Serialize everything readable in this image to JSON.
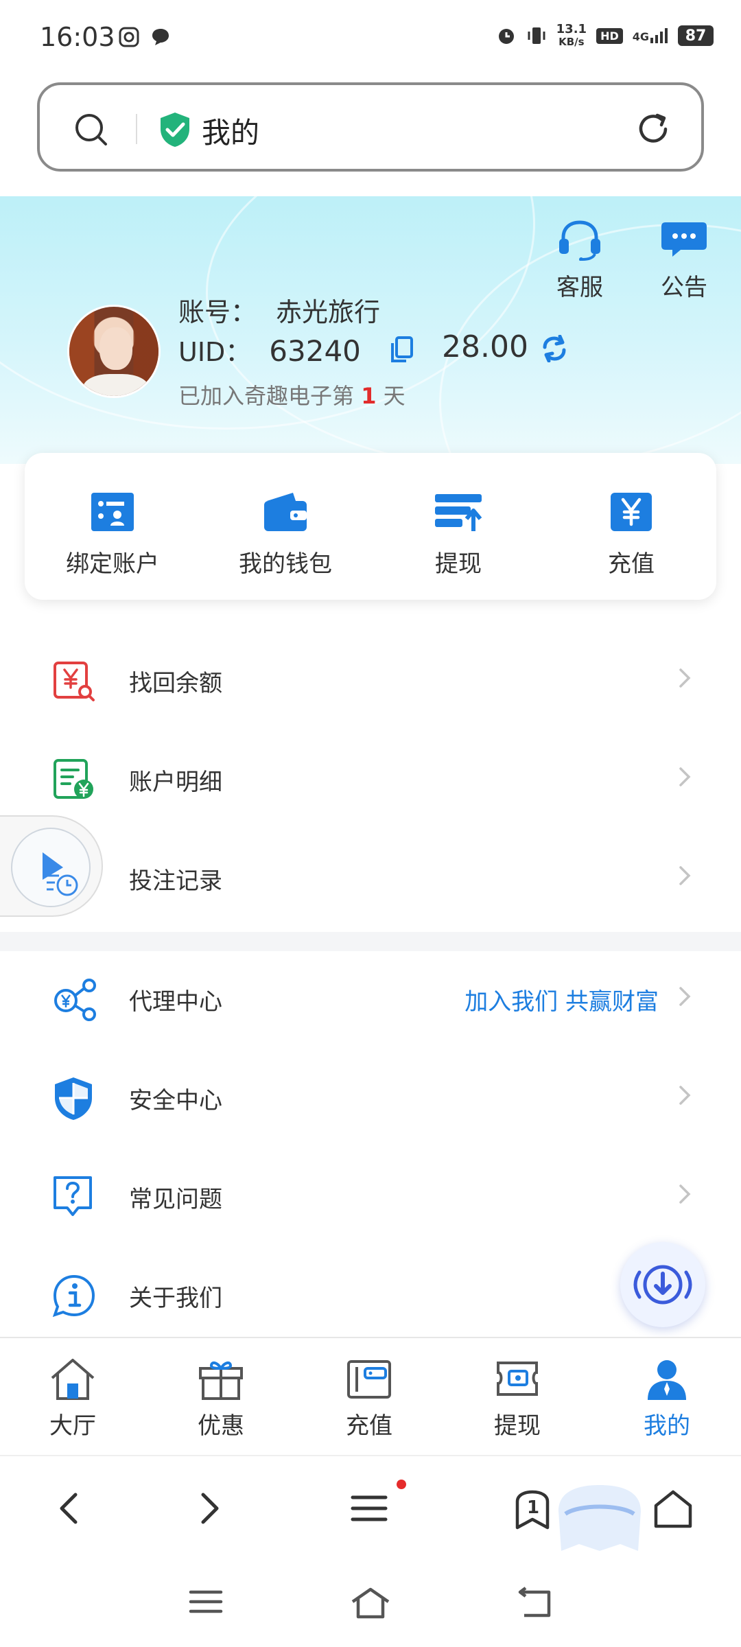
{
  "status_bar": {
    "time": "16:03",
    "net_speed_top": "13.1",
    "net_speed_unit": "KB/s",
    "hd": "HD",
    "network": "4G",
    "battery": "87"
  },
  "url_bar": {
    "title": "我的",
    "icons": [
      "search-icon",
      "shield-check-icon",
      "reload-icon"
    ]
  },
  "header": {
    "actions": [
      {
        "label": "客服",
        "icon": "headset-icon"
      },
      {
        "label": "公告",
        "icon": "chat-bubble-icon"
      }
    ],
    "account_label": "账号：",
    "account_value": "赤光旅行",
    "uid_label": "UID：",
    "uid_value": "63240",
    "balance": "28.00",
    "joined_prefix": "已加入奇趣电子第",
    "joined_days": "1",
    "joined_suffix": "天"
  },
  "quick_actions": [
    {
      "label": "绑定账户",
      "icon": "bind-account-icon"
    },
    {
      "label": "我的钱包",
      "icon": "wallet-icon"
    },
    {
      "label": "提现",
      "icon": "withdraw-icon"
    },
    {
      "label": "充值",
      "icon": "yen-recharge-icon"
    }
  ],
  "menu": [
    {
      "label": "找回余额",
      "icon": "recover-balance-icon"
    },
    {
      "label": "账户明细",
      "icon": "account-detail-icon"
    },
    {
      "label": "投注记录",
      "icon": "bet-record-icon"
    },
    {
      "label": "代理中心",
      "icon": "agent-share-icon",
      "extra": "加入我们 共赢财富"
    },
    {
      "label": "安全中心",
      "icon": "security-shield-icon"
    },
    {
      "label": "常见问题",
      "icon": "faq-icon"
    },
    {
      "label": "关于我们",
      "icon": "info-icon"
    }
  ],
  "tabs": [
    {
      "label": "大厅",
      "icon": "home-icon"
    },
    {
      "label": "优惠",
      "icon": "gift-icon"
    },
    {
      "label": "充值",
      "icon": "recharge-card-icon"
    },
    {
      "label": "提现",
      "icon": "withdraw-ticket-icon"
    },
    {
      "label": "我的",
      "icon": "user-icon",
      "active": true
    }
  ],
  "browser_nav": {
    "tab_count": "1"
  },
  "colors": {
    "accent": "#1d7ee0",
    "highlight_red": "#e12c2c",
    "header_bg": "#bdf0f8"
  }
}
